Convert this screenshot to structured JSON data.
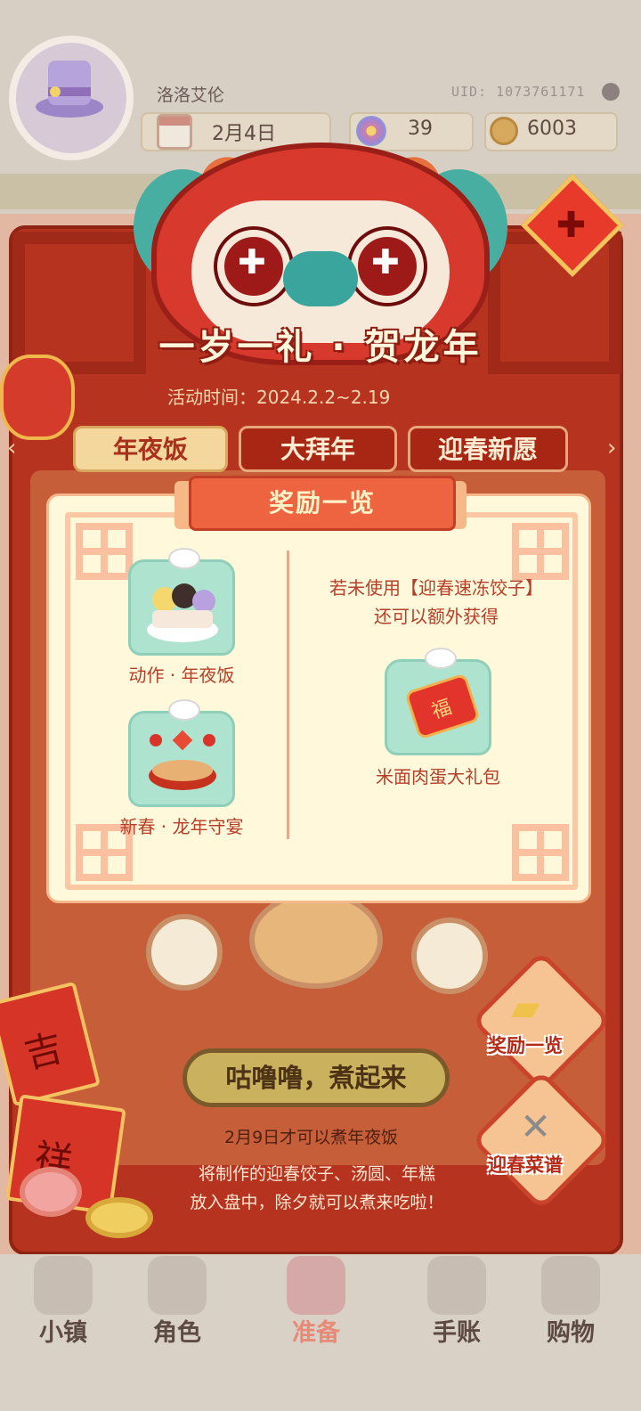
{
  "player": {
    "name": "洛洛艾伦",
    "uid": "UID: 1073761171",
    "date": "2月4日",
    "flowers": "39",
    "coins": "6003"
  },
  "event": {
    "title": "一岁一礼 · 贺龙年",
    "time": "活动时间：2024.2.2~2.19",
    "fu": "✚"
  },
  "tabs": [
    {
      "label": "年夜饭",
      "active": true
    },
    {
      "label": "大拜年",
      "active": false
    },
    {
      "label": "迎春新愿",
      "active": false
    }
  ],
  "modal": {
    "title": "奖励一览",
    "note_line1": "若未使用【迎春速冻饺子】",
    "note_line2": "还可以额外获得",
    "rewards_left": [
      {
        "label": "动作 · 年夜饭"
      },
      {
        "label": "新春 · 龙年守宴"
      }
    ],
    "reward_right": {
      "label": "米面肉蛋大礼包",
      "icon_char": "福"
    }
  },
  "cooking": {
    "button": "咕噜噜，煮起来",
    "hint": "2月9日才可以煮年夜饭",
    "desc_line1": "将制作的迎春饺子、汤圆、年糕",
    "desc_line2": "放入盘中，除夕就可以煮来吃啦！"
  },
  "side_buttons": {
    "rewards": "奖励一览",
    "recipes": "迎春菜谱"
  },
  "decor": {
    "env1": "吉",
    "env2": "祥"
  },
  "nav": [
    {
      "label": "小镇",
      "active": false
    },
    {
      "label": "角色",
      "active": false
    },
    {
      "label": "准备",
      "active": true
    },
    {
      "label": "手账",
      "active": false
    },
    {
      "label": "购物",
      "active": false
    }
  ],
  "colors": {
    "panel_red": "#b6331f",
    "modal_bg": "#fff8da",
    "accent_orange": "#ee6440",
    "text_red": "#b5402a"
  }
}
